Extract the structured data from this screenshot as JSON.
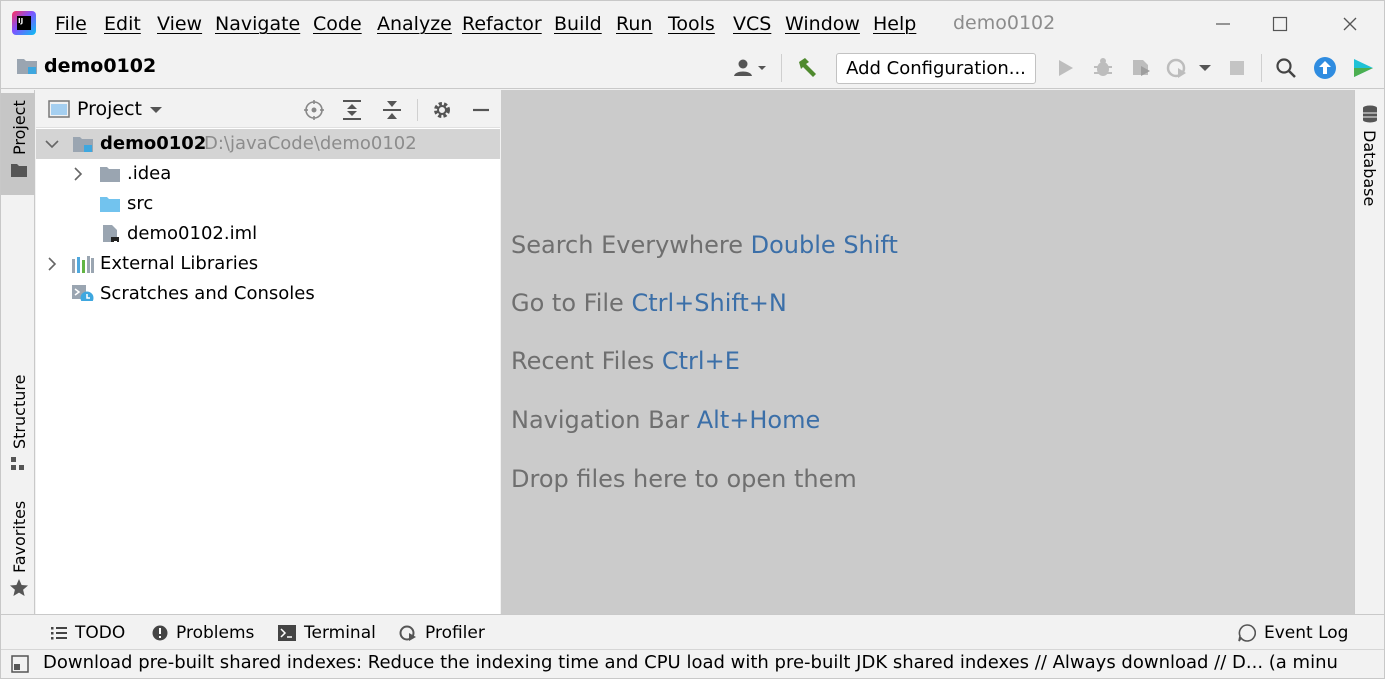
{
  "menubar": {
    "items": [
      "File",
      "Edit",
      "View",
      "Navigate",
      "Code",
      "Analyze",
      "Refactor",
      "Build",
      "Run",
      "Tools",
      "VCS",
      "Window",
      "Help"
    ],
    "project_title": "demo0102"
  },
  "toolbar": {
    "breadcrumb": "demo0102",
    "add_configuration": "Add Configuration..."
  },
  "left_stripe": {
    "project": "Project",
    "structure": "Structure",
    "favorites": "Favorites"
  },
  "right_stripe": {
    "database": "Database"
  },
  "project_panel": {
    "title": "Project",
    "tree": [
      {
        "label": "demo0102",
        "path": "D:\\javaCode\\demo0102"
      },
      {
        "label": ".idea"
      },
      {
        "label": "src"
      },
      {
        "label": "demo0102.iml"
      },
      {
        "label": "External Libraries"
      },
      {
        "label": "Scratches and Consoles"
      }
    ]
  },
  "editor": {
    "hints": [
      {
        "text": "Search Everywhere",
        "key": "Double Shift"
      },
      {
        "text": "Go to File",
        "key": "Ctrl+Shift+N"
      },
      {
        "text": "Recent Files",
        "key": "Ctrl+E"
      },
      {
        "text": "Navigation Bar",
        "key": "Alt+Home"
      },
      {
        "text": "Drop files here to open them",
        "key": ""
      }
    ]
  },
  "bottom_tabs": {
    "todo": "TODO",
    "problems": "Problems",
    "terminal": "Terminal",
    "profiler": "Profiler",
    "event_log": "Event Log"
  },
  "status": {
    "message": "Download pre-built shared indexes: Reduce the indexing time and CPU load with pre-built JDK shared indexes // Always download // D... (a minute ago)"
  },
  "colors": {
    "accent_key": "#3b6fa8",
    "editor_bg": "#cbcbcb",
    "selection": "#d4d4d4",
    "build_green": "#4f8a2e",
    "update_blue": "#2f8ce0"
  }
}
